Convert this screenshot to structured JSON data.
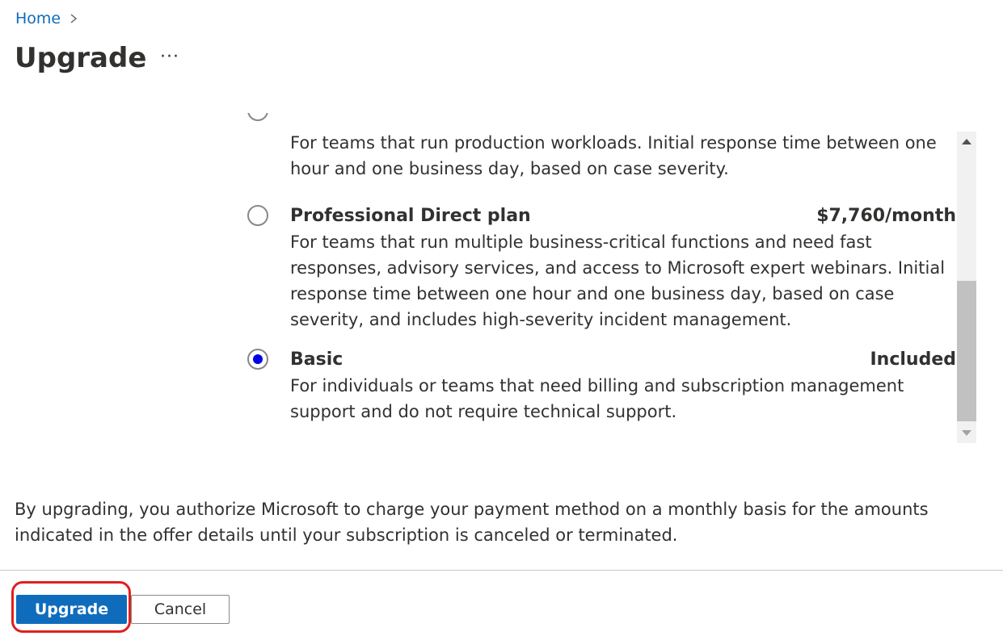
{
  "breadcrumb": {
    "home_label": "Home"
  },
  "page": {
    "title": "Upgrade",
    "more_label": "···"
  },
  "plans": [
    {
      "name": "",
      "price": "",
      "description": "For teams that run production workloads. Initial response time between one hour and one business day, based on case severity.",
      "selected": false
    },
    {
      "name": "Professional Direct plan",
      "price": "$7,760/month",
      "description": "For teams that run multiple business-critical functions and need fast responses, advisory services, and access to Microsoft expert webinars. Initial response time between one hour and one business day, based on case severity, and includes high-severity incident management.",
      "selected": false
    },
    {
      "name": "Basic",
      "price": "Included",
      "description": "For individuals or teams that need billing and subscription management support and do not require technical support.",
      "selected": true
    }
  ],
  "notice": "By upgrading, you authorize Microsoft to charge your payment method on a monthly basis for the amounts indicated in the offer details until your subscription is canceled or terminated.",
  "actions": {
    "upgrade_label": "Upgrade",
    "cancel_label": "Cancel"
  },
  "colors": {
    "accent": "#0f6cbd",
    "radio_selected": "#0000e6",
    "highlight": "#e02020"
  }
}
